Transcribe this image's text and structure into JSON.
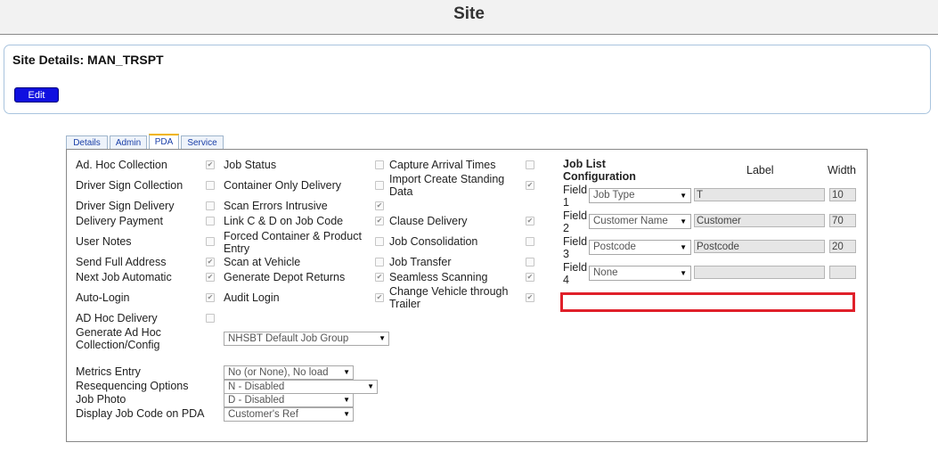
{
  "page": {
    "title": "Site"
  },
  "site": {
    "heading": "Site Details: MAN_TRSPT",
    "edit_label": "Edit"
  },
  "tabs": [
    {
      "label": "Details",
      "active": false
    },
    {
      "label": "Admin",
      "active": false
    },
    {
      "label": "PDA",
      "active": true
    },
    {
      "label": "Service",
      "active": false
    }
  ],
  "col1": [
    {
      "label": "Ad. Hoc Collection",
      "checked": true
    },
    {
      "label": "Driver Sign Collection",
      "checked": false
    },
    {
      "label": "Driver Sign Delivery",
      "checked": false
    },
    {
      "label": "Delivery Payment",
      "checked": false
    },
    {
      "label": "User Notes",
      "checked": false
    },
    {
      "label": "Send Full Address",
      "checked": true
    },
    {
      "label": "Next Job Automatic",
      "checked": true
    },
    {
      "label": "Auto-Login",
      "checked": true
    },
    {
      "label": "AD Hoc Delivery",
      "checked": false
    }
  ],
  "col2": [
    {
      "label": "Job Status",
      "checked": false
    },
    {
      "label": "Container Only Delivery",
      "checked": false
    },
    {
      "label": "Scan Errors Intrusive",
      "checked": true
    },
    {
      "label": "Link C & D on Job Code",
      "checked": true
    },
    {
      "label": "Forced Container & Product Entry",
      "checked": false
    },
    {
      "label": "Scan at Vehicle",
      "checked": false
    },
    {
      "label": "Generate Depot Returns",
      "checked": true
    },
    {
      "label": "Audit Login",
      "checked": true
    }
  ],
  "col3": [
    {
      "label": "Capture Arrival Times",
      "checked": false
    },
    {
      "label": "Import Create Standing Data",
      "checked": true
    },
    {
      "label": "Clause Delivery",
      "checked": true
    },
    {
      "label": "Job Consolidation",
      "checked": false
    },
    {
      "label": "Job Transfer",
      "checked": false
    },
    {
      "label": "Seamless Scanning",
      "checked": true
    },
    {
      "label": "Change Vehicle through Trailer",
      "checked": true
    }
  ],
  "generate_adhoc": {
    "label": "Generate Ad Hoc Collection/Config",
    "value": "NHSBT Default Job Group"
  },
  "dropdowns": [
    {
      "label": "Metrics Entry",
      "value": "No (or None), No load"
    },
    {
      "label": "Resequencing Options",
      "value": "N - Disabled"
    },
    {
      "label": "Job Photo",
      "value": "D - Disabled"
    },
    {
      "label": "Display Job Code on PDA",
      "value": "Customer's Ref"
    }
  ],
  "job_list": {
    "title": "Job List Configuration",
    "label_header": "Label",
    "width_header": "Width",
    "fields": [
      {
        "name": "Field 1",
        "type": "Job Type",
        "label": "T",
        "width": "10"
      },
      {
        "name": "Field 2",
        "type": "Customer Name",
        "label": "Customer",
        "width": "70"
      },
      {
        "name": "Field 3",
        "type": "Postcode",
        "label": "Postcode",
        "width": "20"
      },
      {
        "name": "Field 4",
        "type": "None",
        "label": "",
        "width": ""
      }
    ]
  },
  "colors": {
    "highlight": "#e0202a",
    "edit_button": "#0f0fe0",
    "panel_border": "#a9c4de"
  }
}
